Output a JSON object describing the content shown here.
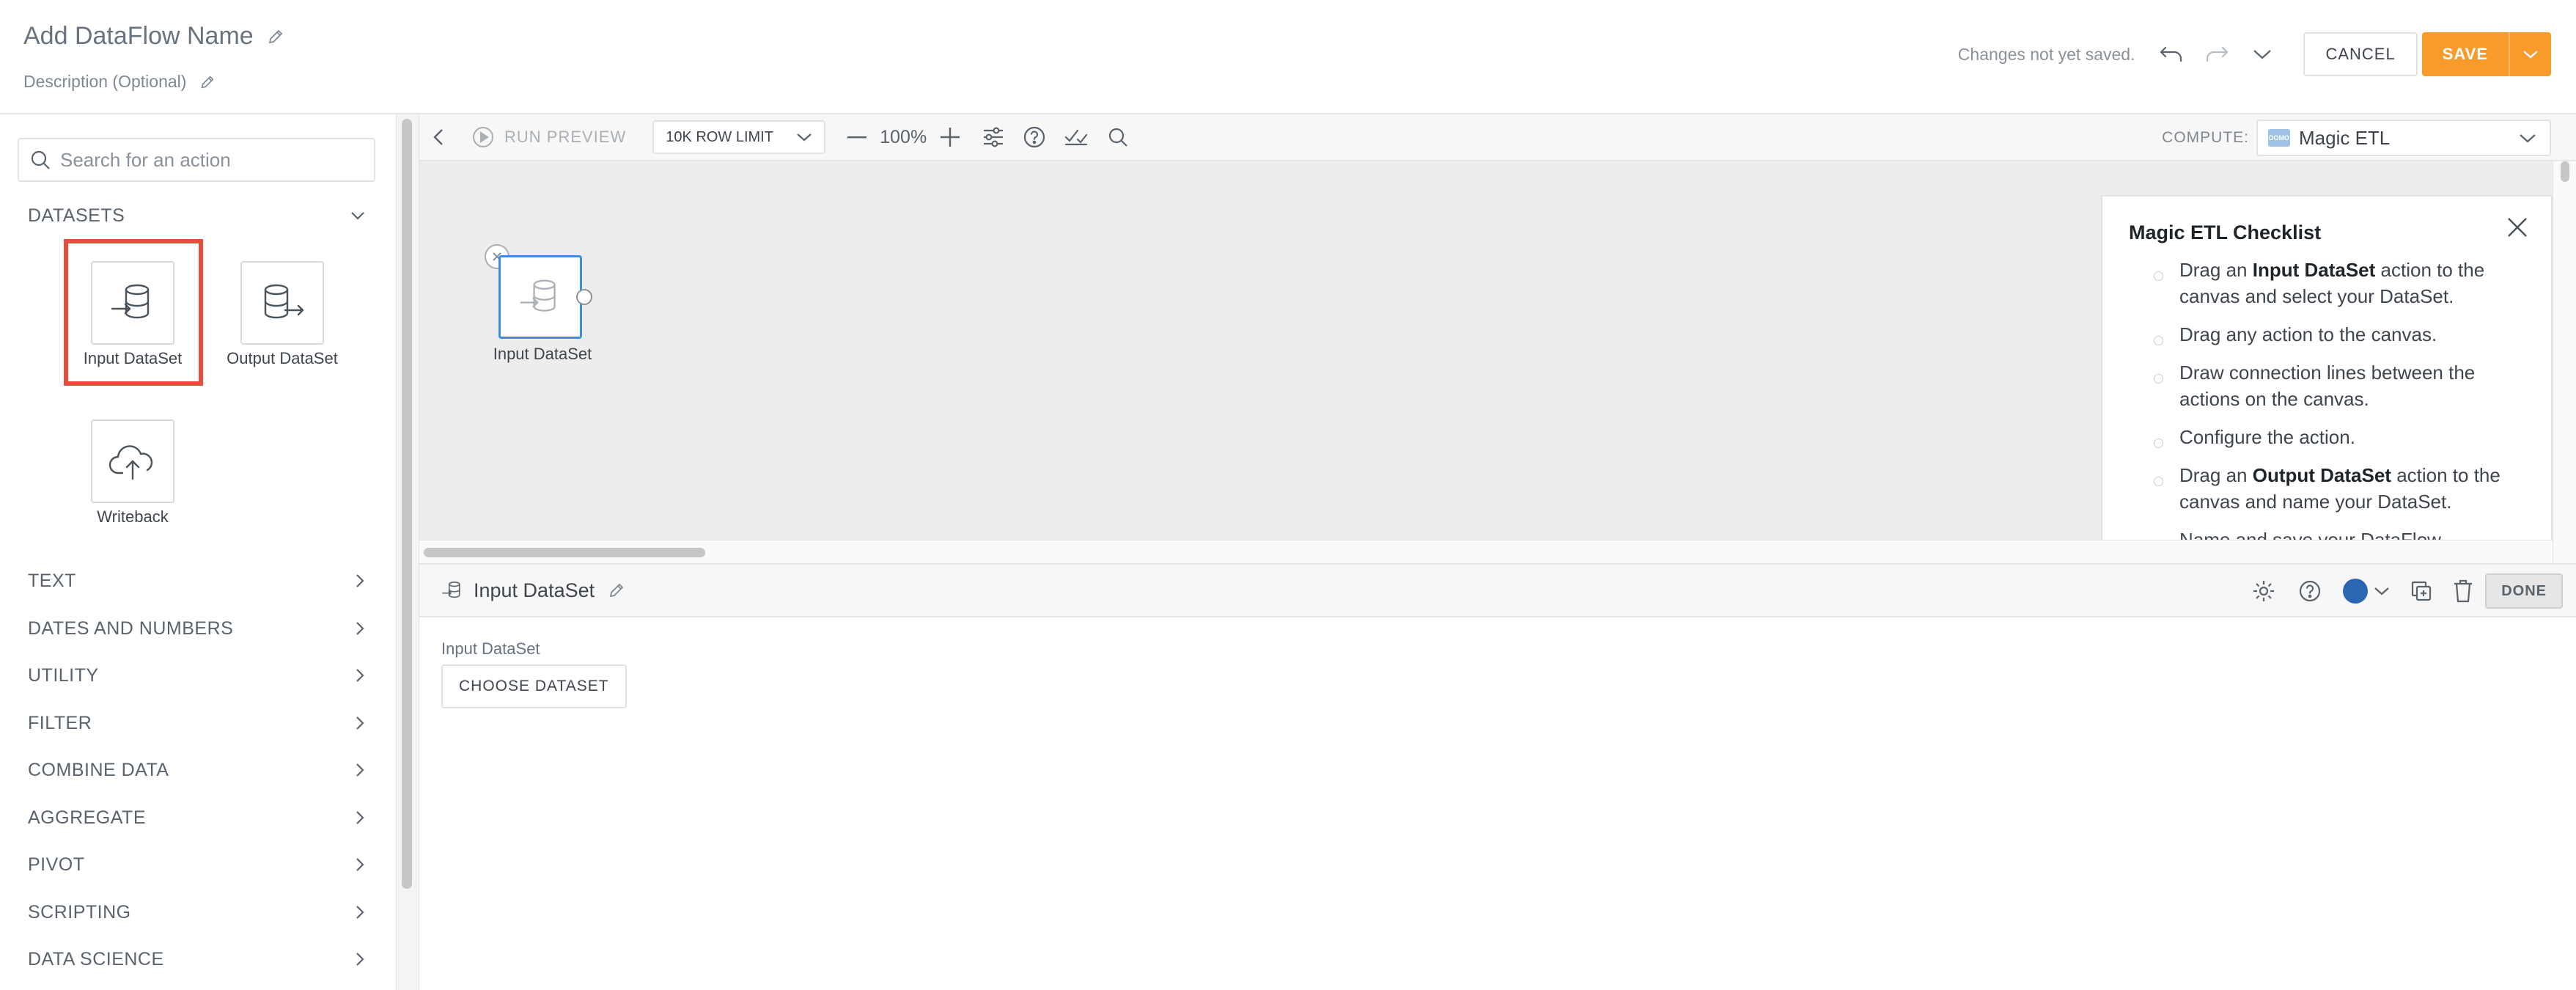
{
  "header": {
    "title": "Add DataFlow Name",
    "description": "Description (Optional)",
    "status": "Changes not yet saved.",
    "cancel_label": "CANCEL",
    "save_label": "SAVE",
    "accent_color": "#f99b2a"
  },
  "sidebar": {
    "search_placeholder": "Search for an action",
    "datasets_label": "DATASETS",
    "dataset_tiles": [
      {
        "label": "Input DataSet",
        "icon": "database-input-icon",
        "selected": true
      },
      {
        "label": "Output DataSet",
        "icon": "database-output-icon",
        "selected": false
      },
      {
        "label": "Writeback",
        "icon": "cloud-upload-icon",
        "selected": false
      }
    ],
    "categories": [
      "TEXT",
      "DATES AND NUMBERS",
      "UTILITY",
      "FILTER",
      "COMBINE DATA",
      "AGGREGATE",
      "PIVOT",
      "SCRIPTING",
      "DATA SCIENCE"
    ]
  },
  "toolbar": {
    "run_preview": "RUN PREVIEW",
    "row_limit": "10K ROW LIMIT",
    "zoom": "100%",
    "compute_label": "COMPUTE:",
    "compute_value": "Magic ETL",
    "compute_logo_text": "DOMO"
  },
  "canvas": {
    "node_label": "Input DataSet"
  },
  "checklist": {
    "title": "Magic ETL Checklist",
    "items": [
      {
        "before": "Drag an ",
        "bold": "Input DataSet",
        "after": " action to the canvas and select your DataSet."
      },
      {
        "before": "Drag any action to the canvas.",
        "bold": "",
        "after": ""
      },
      {
        "before": "Draw connection lines between the actions on the canvas.",
        "bold": "",
        "after": ""
      },
      {
        "before": "Configure the action.",
        "bold": "",
        "after": ""
      },
      {
        "before": "Drag an ",
        "bold": "Output DataSet",
        "after": " action to the canvas and name your DataSet."
      },
      {
        "before": "Name and save your DataFlow",
        "bold": "",
        "after": ""
      }
    ]
  },
  "details": {
    "title": "Input DataSet",
    "field_label": "Input DataSet",
    "choose_label": "CHOOSE DATASET",
    "done_label": "DONE",
    "node_color": "#2b66b3"
  }
}
